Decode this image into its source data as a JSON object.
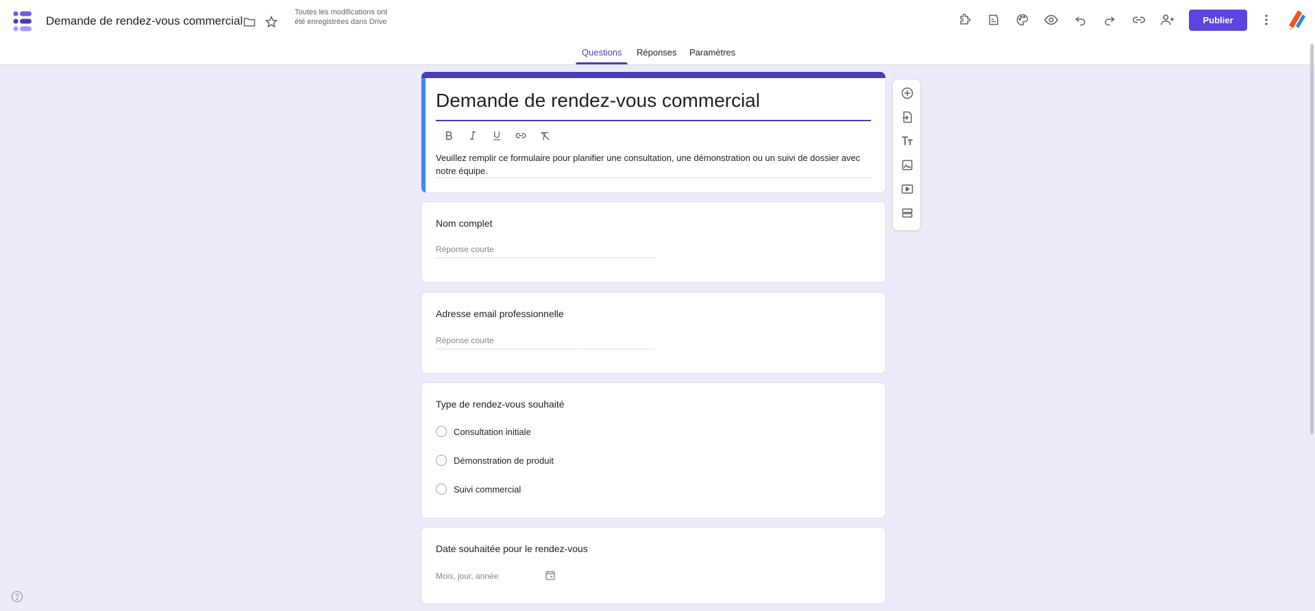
{
  "header": {
    "doc_title": "Demande de rendez-vous commercial",
    "save_status": "Toutes les modifications ont été enregistrées dans Drive",
    "publish_label": "Publier",
    "icons": [
      "folder-icon",
      "star-icon",
      "addon-icon",
      "ai-summary-icon",
      "palette-icon",
      "preview-icon",
      "undo-icon",
      "redo-icon",
      "link-icon",
      "add-collaborator-icon",
      "more-vert-icon"
    ]
  },
  "tabs": [
    {
      "label": "Questions",
      "active": true
    },
    {
      "label": "Réponses",
      "active": false
    },
    {
      "label": "Paramètres",
      "active": false
    }
  ],
  "form": {
    "title": "Demande de rendez-vous commercial",
    "description": "Veuillez remplir ce formulaire pour planifier une consultation, une démonstration ou un suivi de dossier avec notre équipe.",
    "format_tools": [
      "bold-icon",
      "italic-icon",
      "underline-icon",
      "link-icon",
      "clear-format-icon"
    ]
  },
  "questions": [
    {
      "title": "Nom complet",
      "type": "short",
      "placeholder": "Réponse courte"
    },
    {
      "title": "Adresse email professionnelle",
      "type": "short",
      "placeholder": "Réponse courte"
    },
    {
      "title": "Type de rendez-vous souhaité",
      "type": "radio",
      "options": [
        "Consultation initiale",
        "Démonstration de produit",
        "Suivi commercial"
      ]
    },
    {
      "title": "Date souhaitée pour le rendez-vous",
      "type": "date",
      "placeholder": "Mois, jour, année"
    }
  ],
  "side_toolbar": [
    "add-question-icon",
    "import-questions-icon",
    "add-title-icon",
    "add-image-icon",
    "add-video-icon",
    "add-section-icon"
  ],
  "colors": {
    "accent": "#4b3bb8",
    "publish": "#5b45e0",
    "background": "#ecebfa",
    "title_left_bar": "#4285f4"
  }
}
